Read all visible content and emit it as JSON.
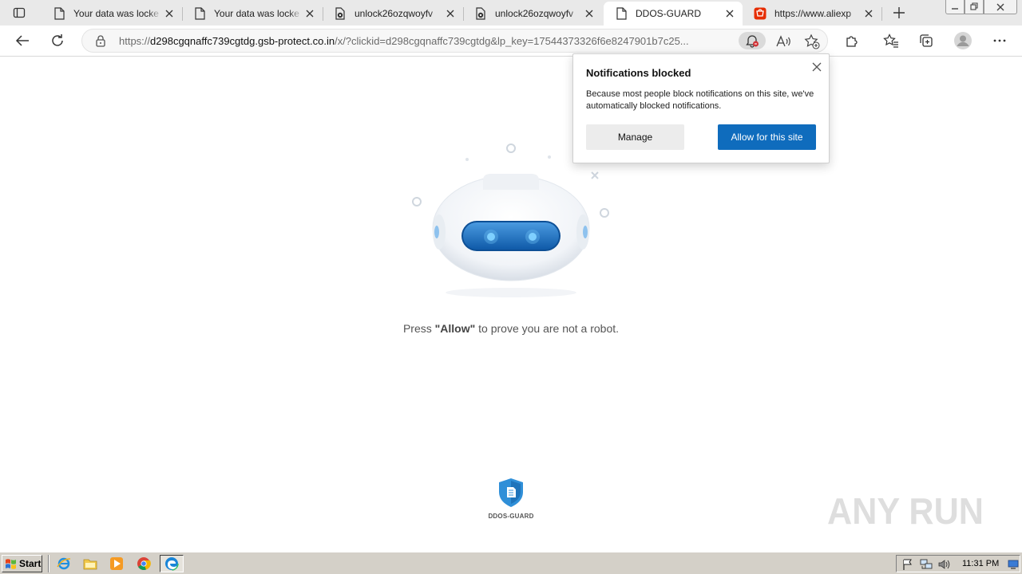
{
  "browser": {
    "tabs": [
      {
        "title": "Your data was locke",
        "icon": "page-icon"
      },
      {
        "title": "Your data was locke",
        "icon": "page-icon"
      },
      {
        "title": "unlock26ozqwoyfv",
        "icon": "gear-page-icon"
      },
      {
        "title": "unlock26ozqwoyfv",
        "icon": "gear-page-icon"
      },
      {
        "title": "DDOS-GUARD",
        "icon": "page-icon",
        "active": true
      },
      {
        "title": "https://www.aliexp",
        "icon": "aliexpress-cart-icon"
      }
    ],
    "address": {
      "scheme": "https://",
      "host": "d298cgqnaffc739cgtdg.gsb-protect.co.in",
      "path": "/x/?clickid=d298cgqnaffc739cgtdg&lp_key=17544373326f6e8247901b7c25..."
    }
  },
  "popup": {
    "title": "Notifications blocked",
    "text": "Because most people block notifications on this site, we've automatically blocked notifications.",
    "manage_label": "Manage",
    "allow_label": "Allow for this site"
  },
  "page": {
    "prompt_before": "Press ",
    "prompt_allow": "\"Allow\"",
    "prompt_after": " to prove you are not a robot.",
    "logo_text": "DDOS-GUARD"
  },
  "watermark": {
    "text": "ANY RUN"
  },
  "taskbar": {
    "start_label": "Start",
    "clock": "11:31 PM"
  },
  "colors": {
    "accent": "#0f6cbd",
    "tab_bar": "#e9e9e9",
    "taskbar": "#d4d0c8",
    "robot_visor": "#1a72c8"
  }
}
